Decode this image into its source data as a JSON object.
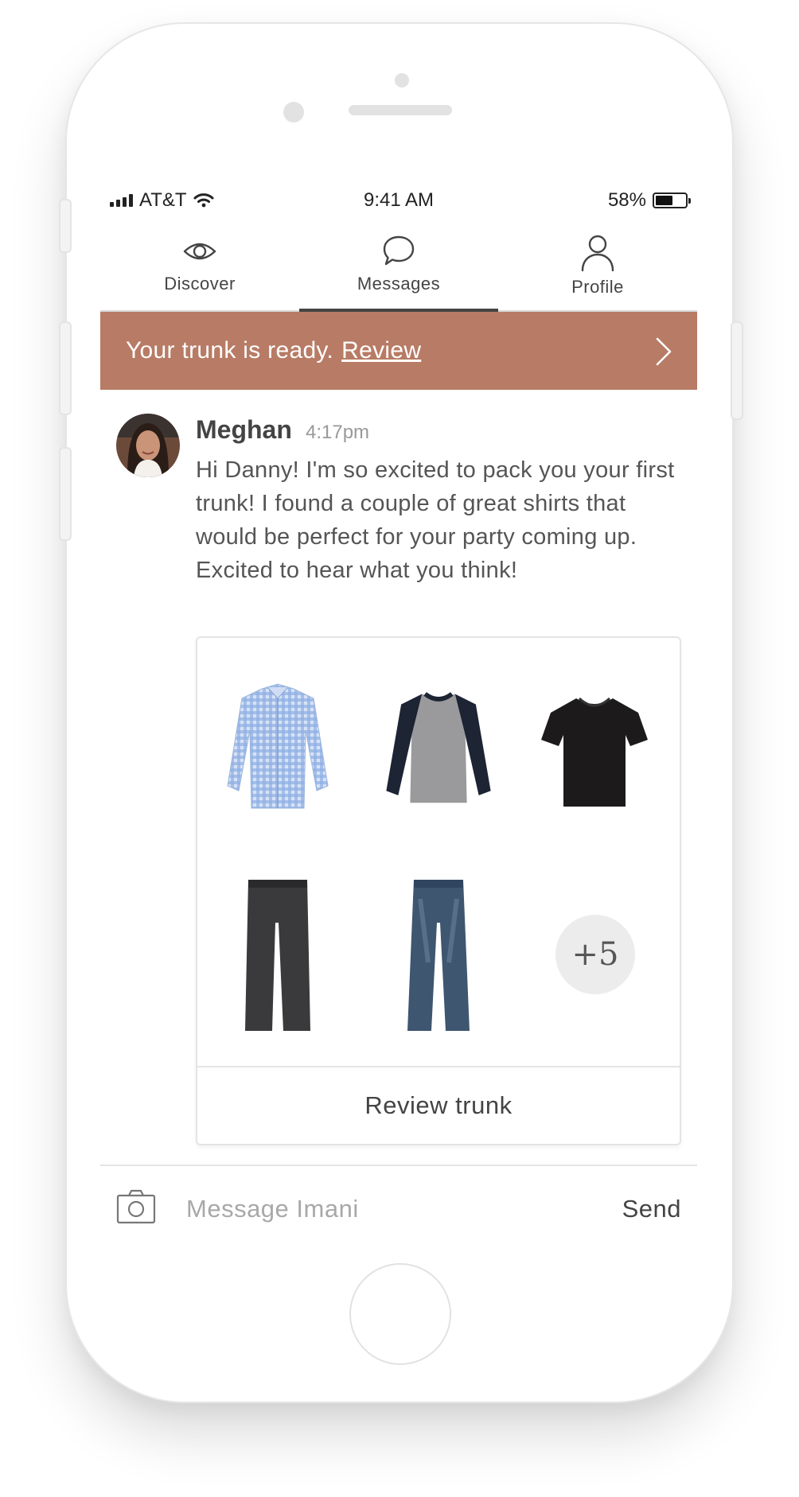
{
  "status_bar": {
    "carrier": "AT&T",
    "time": "9:41 AM",
    "battery_percent": "58%",
    "battery_level": 0.58
  },
  "tabs": [
    {
      "label": "Discover",
      "icon": "eye-icon",
      "active": false
    },
    {
      "label": "Messages",
      "icon": "chat-bubble-icon",
      "active": true
    },
    {
      "label": "Profile",
      "icon": "person-icon",
      "active": false
    }
  ],
  "banner": {
    "text": "Your trunk is ready.",
    "link": "Review",
    "background": "#b87b65"
  },
  "message": {
    "sender": "Meghan",
    "time": "4:17pm",
    "body": "Hi Danny! I'm so excited to pack you your first trunk! I found a couple of great shirts that would be perfect for your party coming up. Excited to hear what you think!"
  },
  "trunk": {
    "items": [
      {
        "icon": "blue-gingham-shirt-icon"
      },
      {
        "icon": "raglan-sweater-icon"
      },
      {
        "icon": "black-tshirt-icon"
      },
      {
        "icon": "gray-pants-icon"
      },
      {
        "icon": "blue-jeans-icon"
      }
    ],
    "more_count": "+5",
    "review_label": "Review trunk"
  },
  "composer": {
    "placeholder": "Message Imani",
    "send_label": "Send"
  }
}
